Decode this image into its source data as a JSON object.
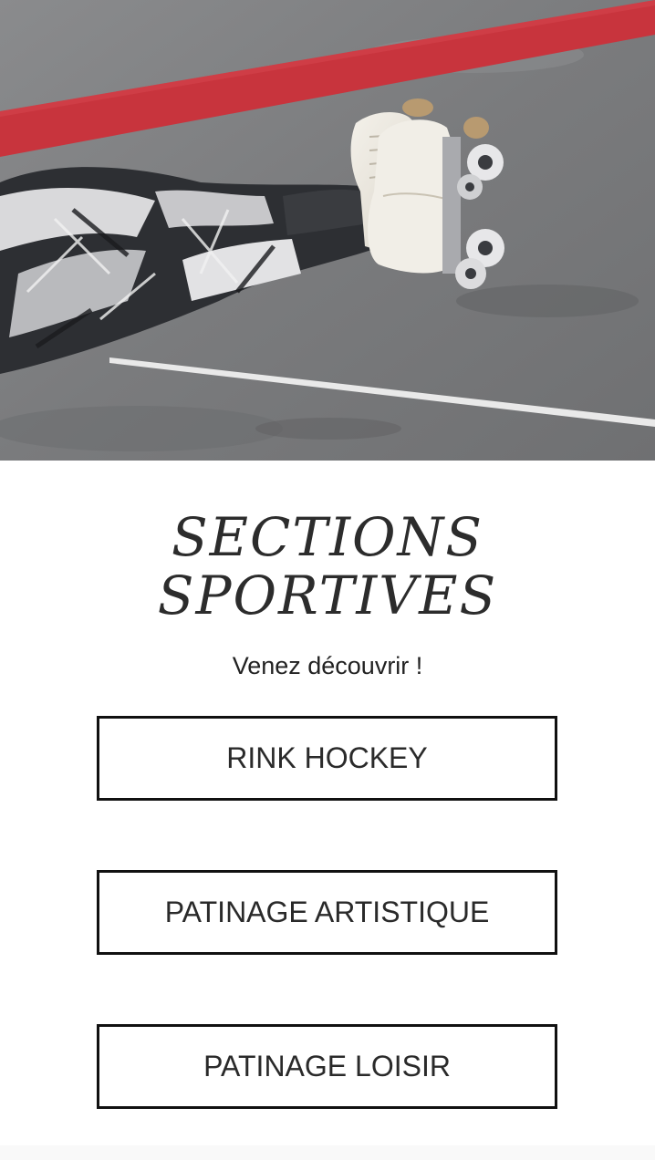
{
  "hero": {
    "image": "roller-skater-lying-on-rink-photo"
  },
  "section": {
    "title_line1": "SECTIONS",
    "title_line2": "SPORTIVES",
    "subtitle": "Venez découvrir !"
  },
  "buttons": [
    {
      "label": "RINK HOCKEY"
    },
    {
      "label": "PATINAGE ARTISTIQUE"
    },
    {
      "label": "PATINAGE LOISIR"
    }
  ],
  "colors": {
    "floor": "#7d7e80",
    "stripe": "#c8343d",
    "button_border": "#111111",
    "title": "#2c2c2c"
  }
}
